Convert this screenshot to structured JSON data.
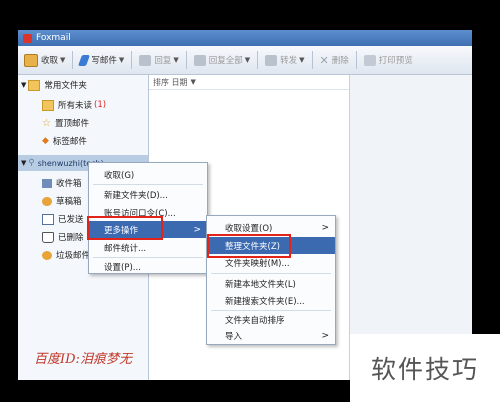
{
  "window": {
    "title": "Foxmail"
  },
  "toolbar": {
    "buttons": [
      {
        "label": "收取",
        "icon": "inbox-icon",
        "enabled": true,
        "has_dropdown": true
      },
      {
        "label": "写邮件",
        "icon": "pen-icon",
        "enabled": true,
        "has_dropdown": true
      },
      {
        "label": "回复",
        "icon": "reply-icon",
        "enabled": false,
        "has_dropdown": true
      },
      {
        "label": "回复全部",
        "icon": "reply-all-icon",
        "enabled": false,
        "has_dropdown": true
      },
      {
        "label": "转发",
        "icon": "forward-icon",
        "enabled": false,
        "has_dropdown": true
      },
      {
        "label": "删除",
        "icon": "delete-icon",
        "enabled": false,
        "has_dropdown": false
      },
      {
        "label": "打印预览",
        "icon": "print-icon",
        "enabled": false,
        "has_dropdown": false
      }
    ]
  },
  "sidebar": {
    "common_folders_label": "常用文件夹",
    "common_folders": [
      {
        "label": "所有未读",
        "count": "(1)",
        "icon": "folder-icon"
      },
      {
        "label": "置顶邮件",
        "icon": "star-icon"
      },
      {
        "label": "标签邮件",
        "icon": "tag-icon"
      }
    ],
    "account_label": "shenwuzhi(tech)",
    "account_folders": [
      {
        "label": "收件箱",
        "icon": "inbox-folder-icon"
      },
      {
        "label": "草稿箱",
        "icon": "draft-icon"
      },
      {
        "label": "已发送",
        "icon": "sent-icon"
      },
      {
        "label": "已删除",
        "icon": "trash-icon"
      },
      {
        "label": "垃圾邮件",
        "icon": "spam-icon"
      }
    ]
  },
  "list": {
    "sort_label": "排序 日期"
  },
  "context_menu": {
    "items": [
      "收取(G)",
      "新建文件夹(D)...",
      "账号访问口令(C)...",
      "更多操作",
      "邮件统计...",
      "设置(P)..."
    ],
    "highlighted": "更多操作"
  },
  "submenu": {
    "items": [
      "收取设置(O)",
      "整理文件夹(Z)",
      "文件夹映射(M)...",
      "新建本地文件夹(L)",
      "新建搜索文件夹(E)...",
      "文件夹自动排序",
      "导入"
    ],
    "highlighted": "整理文件夹(Z)"
  },
  "watermarks": {
    "left": "百度ID:泪痕梦无",
    "right": "软件技巧"
  },
  "colors": {
    "highlight": "#3c6ab0",
    "annotation_box": "#e2231a",
    "watermark_left": "#c0392b"
  }
}
